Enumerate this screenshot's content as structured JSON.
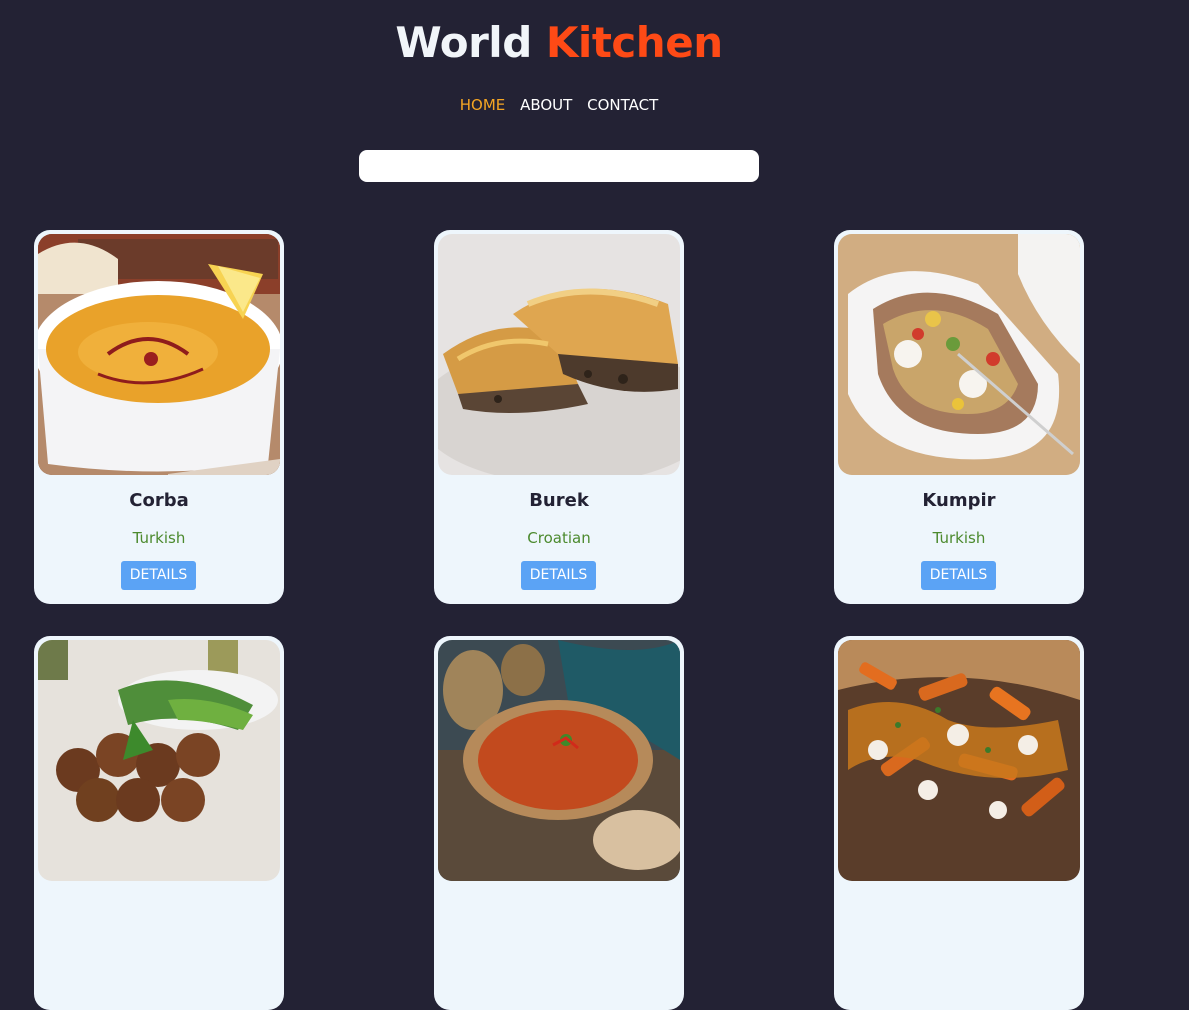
{
  "header": {
    "title_part1": "World",
    "title_part2": "Kitchen"
  },
  "nav": {
    "items": [
      "HOME",
      "ABOUT",
      "CONTACT"
    ],
    "active": "HOME"
  },
  "search": {
    "value": "",
    "placeholder": ""
  },
  "cards": [
    {
      "name": "Corba",
      "origin": "Turkish",
      "button": "DETAILS",
      "image": "lentil-soup-photo"
    },
    {
      "name": "Burek",
      "origin": "Croatian",
      "button": "DETAILS",
      "image": "burek-pastry-photo"
    },
    {
      "name": "Kumpir",
      "origin": "Turkish",
      "button": "DETAILS",
      "image": "stuffed-potato-photo"
    },
    {
      "name": "",
      "origin": "",
      "button": "",
      "image": "falafel-photo"
    },
    {
      "name": "",
      "origin": "",
      "button": "",
      "image": "soup-bowl-photo"
    },
    {
      "name": "",
      "origin": "",
      "button": "",
      "image": "poutine-photo"
    }
  ],
  "colors": {
    "background": "#232234",
    "accent": "#fe4a16",
    "nav_active": "#f5a623",
    "card_bg": "#eef6fc",
    "button_bg": "#5ba3f5",
    "origin_text": "#4c8a2e"
  }
}
